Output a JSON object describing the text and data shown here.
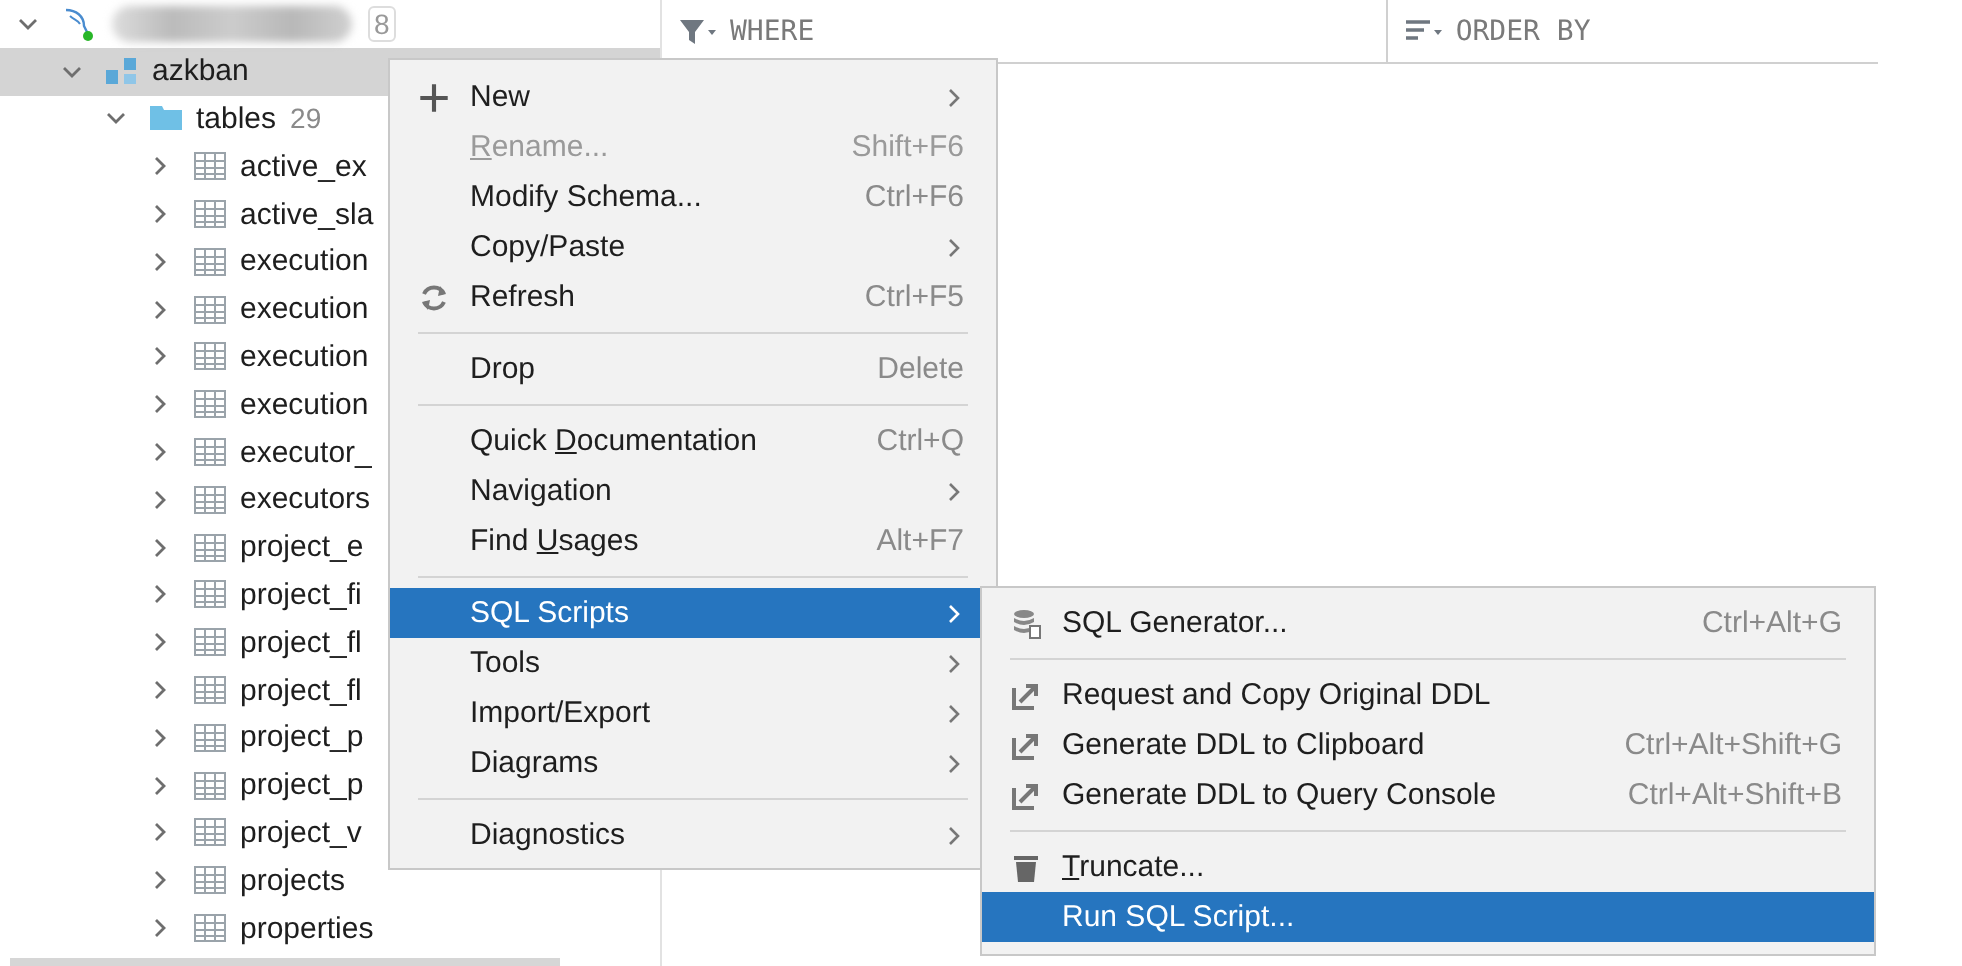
{
  "tree": [
    {
      "count": "8",
      "expanded": true,
      "selected": false,
      "children": [
        {
          "label": "azkban",
          "expanded": true,
          "selected": true,
          "children": [
            {
              "label": "tables",
              "count": "29",
              "expanded": true,
              "selected": false,
              "children": [
                {
                  "label": "active_ex",
                  "expanded": false,
                  "selected": false
                },
                {
                  "label": "active_sla",
                  "expanded": false,
                  "selected": false
                },
                {
                  "label": "execution",
                  "expanded": false,
                  "selected": false
                },
                {
                  "label": "execution",
                  "expanded": false,
                  "selected": false
                },
                {
                  "label": "execution",
                  "expanded": false,
                  "selected": false
                },
                {
                  "label": "execution",
                  "expanded": false,
                  "selected": false
                },
                {
                  "label": "executor_",
                  "expanded": false,
                  "selected": false
                },
                {
                  "label": "executors",
                  "expanded": false,
                  "selected": false
                },
                {
                  "label": "project_e",
                  "expanded": false,
                  "selected": false
                },
                {
                  "label": "project_fi",
                  "expanded": false,
                  "selected": false
                },
                {
                  "label": "project_fl",
                  "expanded": false,
                  "selected": false
                },
                {
                  "label": "project_fl",
                  "expanded": false,
                  "selected": false
                },
                {
                  "label": "project_p",
                  "expanded": false,
                  "selected": false
                },
                {
                  "label": "project_p",
                  "expanded": false,
                  "selected": false
                },
                {
                  "label": "project_v",
                  "expanded": false,
                  "selected": false
                },
                {
                  "label": "projects",
                  "expanded": false,
                  "selected": false
                },
                {
                  "label": "properties",
                  "expanded": false,
                  "selected": false
                }
              ]
            }
          ]
        }
      ]
    }
  ],
  "filter_bar": {
    "where": "WHERE",
    "order_by": "ORDER BY"
  },
  "context_menu": [
    {
      "kind": "item",
      "label": "New",
      "submenu": true,
      "disabled": false,
      "selected": false
    },
    {
      "kind": "item",
      "key": "R",
      "post": "ename...",
      "shortcut": "Shift+F6",
      "submenu": false,
      "disabled": true,
      "selected": false
    },
    {
      "kind": "item",
      "label": "Modify Schema...",
      "shortcut": "Ctrl+F6",
      "submenu": false,
      "disabled": false,
      "selected": false
    },
    {
      "kind": "item",
      "label": "Copy/Paste",
      "submenu": true,
      "disabled": false,
      "selected": false
    },
    {
      "kind": "item",
      "label": "Refresh",
      "shortcut": "Ctrl+F5",
      "submenu": false,
      "disabled": false,
      "selected": false
    },
    {
      "kind": "separator"
    },
    {
      "kind": "item",
      "label": "Drop",
      "shortcut": "Delete",
      "submenu": false,
      "disabled": false,
      "selected": false
    },
    {
      "kind": "separator"
    },
    {
      "kind": "item",
      "pre": "Quick ",
      "key": "D",
      "post": "ocumentation",
      "shortcut": "Ctrl+Q",
      "submenu": false,
      "disabled": false,
      "selected": false
    },
    {
      "kind": "item",
      "label": "Navigation",
      "submenu": true,
      "disabled": false,
      "selected": false
    },
    {
      "kind": "item",
      "pre": "Find ",
      "key": "U",
      "post": "sages",
      "shortcut": "Alt+F7",
      "submenu": false,
      "disabled": false,
      "selected": false
    },
    {
      "kind": "separator"
    },
    {
      "kind": "item",
      "label": "SQL Scripts",
      "submenu": true,
      "disabled": false,
      "selected": true
    },
    {
      "kind": "item",
      "label": "Tools",
      "submenu": true,
      "disabled": false,
      "selected": false
    },
    {
      "kind": "item",
      "label": "Import/Export",
      "submenu": true,
      "disabled": false,
      "selected": false
    },
    {
      "kind": "item",
      "label": "Diagrams",
      "submenu": true,
      "disabled": false,
      "selected": false
    },
    {
      "kind": "separator"
    },
    {
      "kind": "item",
      "label": "Diagnostics",
      "submenu": true,
      "disabled": false,
      "selected": false
    }
  ],
  "submenu": [
    {
      "kind": "item",
      "label": "SQL Generator...",
      "shortcut": "Ctrl+Alt+G",
      "selected": false
    },
    {
      "kind": "separator"
    },
    {
      "kind": "item",
      "label": "Request and Copy Original DDL",
      "selected": false
    },
    {
      "kind": "item",
      "label": "Generate DDL to Clipboard",
      "shortcut": "Ctrl+Alt+Shift+G",
      "selected": false
    },
    {
      "kind": "item",
      "label": "Generate DDL to Query Console",
      "shortcut": "Ctrl+Alt+Shift+B",
      "selected": false
    },
    {
      "kind": "separator"
    },
    {
      "kind": "item",
      "key": "T",
      "post": "runcate...",
      "selected": false
    },
    {
      "kind": "item",
      "label": "Run SQL Script...",
      "selected": true
    }
  ]
}
